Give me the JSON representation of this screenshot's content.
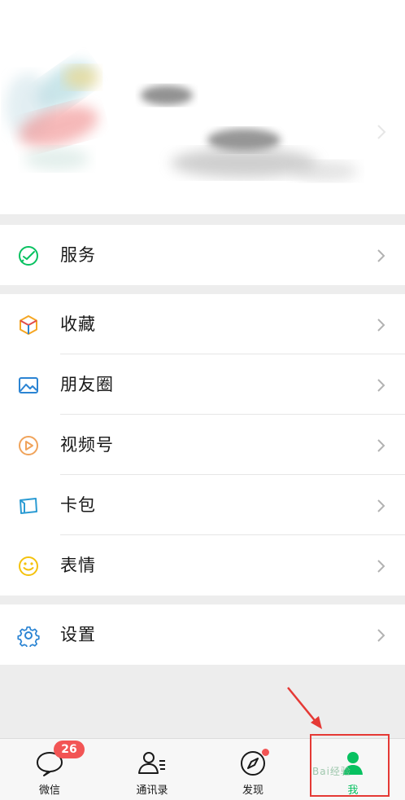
{
  "profile": {
    "blurred": true
  },
  "menu_groups": [
    {
      "items": [
        {
          "label": "服务",
          "icon": "wechat-pay-icon",
          "color": "#07c160"
        }
      ]
    },
    {
      "items": [
        {
          "label": "收藏",
          "icon": "cube-icon",
          "color": "#f5a623"
        },
        {
          "label": "朋友圈",
          "icon": "image-icon",
          "color": "#2b84d3"
        },
        {
          "label": "视频号",
          "icon": "play-circle-icon",
          "color": "#f0a35a"
        },
        {
          "label": "卡包",
          "icon": "card-icon",
          "color": "#2b9bd3"
        },
        {
          "label": "表情",
          "icon": "smile-icon",
          "color": "#f4c20d"
        }
      ]
    },
    {
      "items": [
        {
          "label": "设置",
          "icon": "gear-icon",
          "color": "#2b84d3"
        }
      ]
    }
  ],
  "tabbar": {
    "tabs": [
      {
        "label": "微信",
        "icon": "chat-bubble-icon",
        "badge": "26"
      },
      {
        "label": "通讯录",
        "icon": "contacts-icon"
      },
      {
        "label": "发现",
        "icon": "compass-icon",
        "dot": true
      },
      {
        "label": "我",
        "icon": "person-icon",
        "active": true
      }
    ],
    "active_color": "#07c160"
  },
  "annotation": {
    "color": "#e53935",
    "watermark": "Bai经验"
  }
}
